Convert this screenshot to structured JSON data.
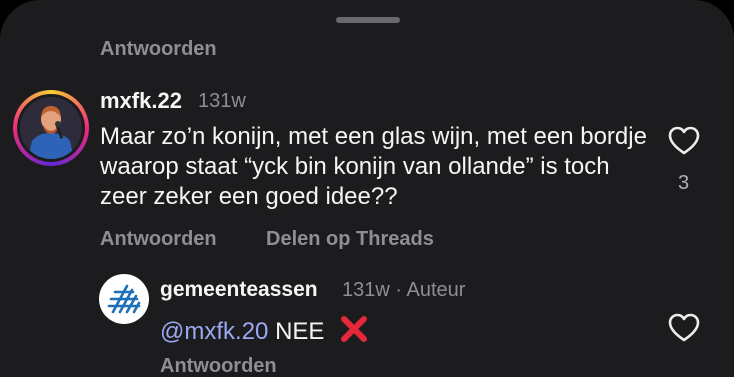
{
  "top_reply_label": "Antwoorden",
  "comment": {
    "username": "mxfk.22",
    "time": "131w",
    "text": "Maar zo’n konijn, met een glas wijn, met een bordje waarop staat “yck bin konijn van ollande” is toch zeer zeker een goed idee??",
    "like_count": "3",
    "reply_label": "Antwoorden",
    "share_label": "Delen op Threads"
  },
  "reply": {
    "username": "gemeenteassen",
    "time": "131w",
    "separator": "·",
    "role": "Auteur",
    "mention": "@mxfk.20",
    "text": "NEE",
    "reply_label": "Antwoorden"
  },
  "icons": {
    "like": "heart-outline-icon",
    "reaction": "red-cross-emoji"
  },
  "colors": {
    "background": "#1c1c1e",
    "mention": "#9ba8f2",
    "muted": "#8e8e93",
    "cross": "#e5283a"
  }
}
